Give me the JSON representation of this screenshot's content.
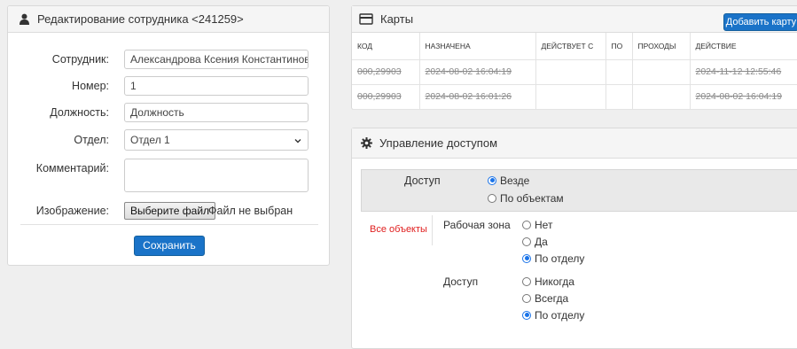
{
  "employee_panel": {
    "title": "Редактирование сотрудника <241259>",
    "fields": {
      "employee_label": "Сотрудник:",
      "employee_value": "Александрова Ксения Константиновна",
      "number_label": "Номер:",
      "number_value": "1",
      "position_label": "Должность:",
      "position_value": "Должность",
      "department_label": "Отдел:",
      "department_value": "Отдел 1",
      "comment_label": "Комментарий:",
      "comment_value": "",
      "image_label": "Изображение:",
      "file_button": "Выберите файл",
      "file_status": "Файл не выбран"
    },
    "save_button": "Сохранить"
  },
  "cards_panel": {
    "title": "Карты",
    "add_button": "Добавить карту",
    "columns": [
      "КОД",
      "НАЗНАЧЕНА",
      "ДЕЙСТВУЕТ С",
      "ПО",
      "ПРОХОДЫ",
      "ДЕЙСТВИЕ"
    ],
    "rows": [
      [
        "000,29903",
        "2024-08-02 16:04:19",
        "",
        "",
        "",
        "2024-11-12 12:55:46"
      ],
      [
        "000,29903",
        "2024-08-02 16:01:26",
        "",
        "",
        "",
        "2024-08-02 16:04:19"
      ]
    ]
  },
  "access_panel": {
    "title": "Управление доступом",
    "access_label": "Доступ",
    "access_options": [
      "Везде",
      "По объектам"
    ],
    "access_selected": "Везде",
    "all_objects": "Все объекты",
    "work_zone_label": "Рабочая зона",
    "work_zone_options": [
      "Нет",
      "Да",
      "По отделу"
    ],
    "work_zone_selected": "По отделу",
    "access2_label": "Доступ",
    "access2_options": [
      "Никогда",
      "Всегда",
      "По отделу"
    ],
    "access2_selected": "По отделу"
  },
  "colors": {
    "primary": "#1a73c8",
    "radio_selected": "#1a73e8",
    "all_objects_text": "#e02020",
    "panel_header": "#f5f5f5"
  },
  "icons": {
    "employee_panel": "user-icon",
    "cards_panel": "credit-card-icon",
    "access_panel": "gear-icon",
    "department_select": "chevron-down-icon"
  }
}
